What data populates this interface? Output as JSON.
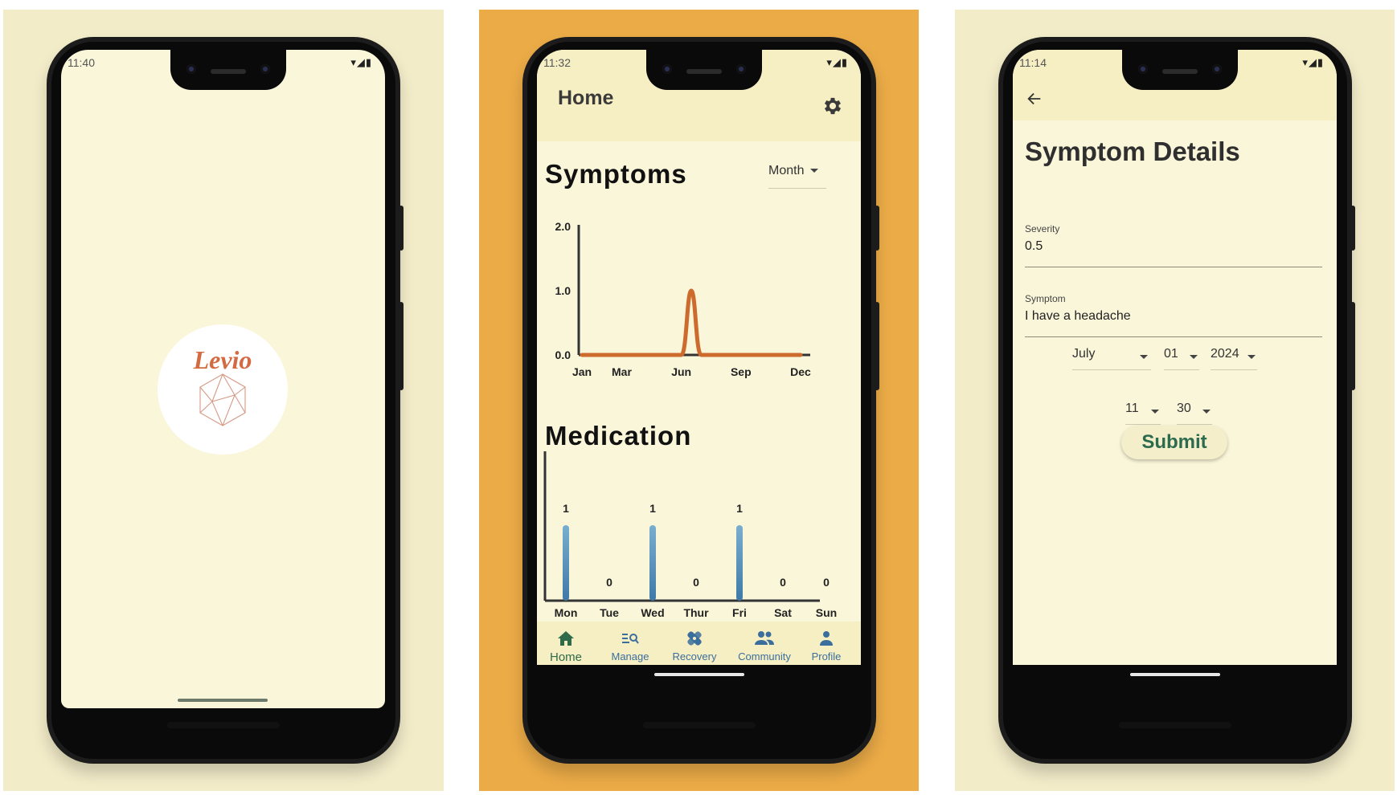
{
  "screens": {
    "splash": {
      "status_time": "11:40",
      "status_icons": "▾◢▮",
      "logo_text": "Levio"
    },
    "home": {
      "status_time": "11:32",
      "status_icons": "▾◢▮",
      "title": "Home",
      "symptoms_title": "Symptoms",
      "range_dropdown": "Month",
      "medication_title": "Medication",
      "nav": [
        {
          "label": "Home",
          "icon": "home-icon"
        },
        {
          "label": "Manage",
          "icon": "manage-search-icon"
        },
        {
          "label": "Recovery",
          "icon": "bandage-icon"
        },
        {
          "label": "Community",
          "icon": "people-icon"
        },
        {
          "label": "Profile",
          "icon": "person-icon"
        }
      ]
    },
    "details": {
      "status_time": "11:14",
      "status_icons": "▾◢▮",
      "title": "Symptom Details",
      "severity_label": "Severity",
      "severity_value": "0.5",
      "symptom_label": "Symptom",
      "symptom_value": "I have a headache",
      "month": "July",
      "day": "01",
      "year": "2024",
      "hour": "11",
      "minute": "30",
      "submit_label": "Submit"
    }
  },
  "colors": {
    "cream": "#faf6d9",
    "appbar": "#f7efc4",
    "orange_bg": "#ebab47",
    "line": "#cd6a2e",
    "bar": "#4e8ab4",
    "nav_active": "#2f6b4a",
    "nav": "#3b6e9c"
  },
  "chart_data": [
    {
      "type": "line",
      "x": [
        "Jan",
        "Mar",
        "Jun",
        "Sep",
        "Dec"
      ],
      "ytick_labels": [
        "0.0",
        "1.0",
        "2.0"
      ],
      "ylim": [
        0,
        2
      ],
      "series_points": [
        [
          1,
          0
        ],
        [
          2,
          0
        ],
        [
          3,
          0
        ],
        [
          4,
          0
        ],
        [
          5,
          0
        ],
        [
          6,
          0
        ],
        [
          6.5,
          1.0
        ],
        [
          7,
          0
        ],
        [
          8,
          0
        ],
        [
          9,
          0
        ],
        [
          10,
          0
        ],
        [
          11,
          0
        ],
        [
          12,
          0
        ]
      ],
      "x_ticks_months": [
        1,
        3,
        6,
        9,
        12
      ],
      "grid": false
    },
    {
      "type": "bar",
      "categories": [
        "Mon",
        "Tue",
        "Wed",
        "Thur",
        "Fri",
        "Sat",
        "Sun"
      ],
      "values": [
        1,
        0,
        1,
        0,
        1,
        0,
        0
      ],
      "ylim": [
        0,
        1
      ],
      "grid": false
    }
  ]
}
